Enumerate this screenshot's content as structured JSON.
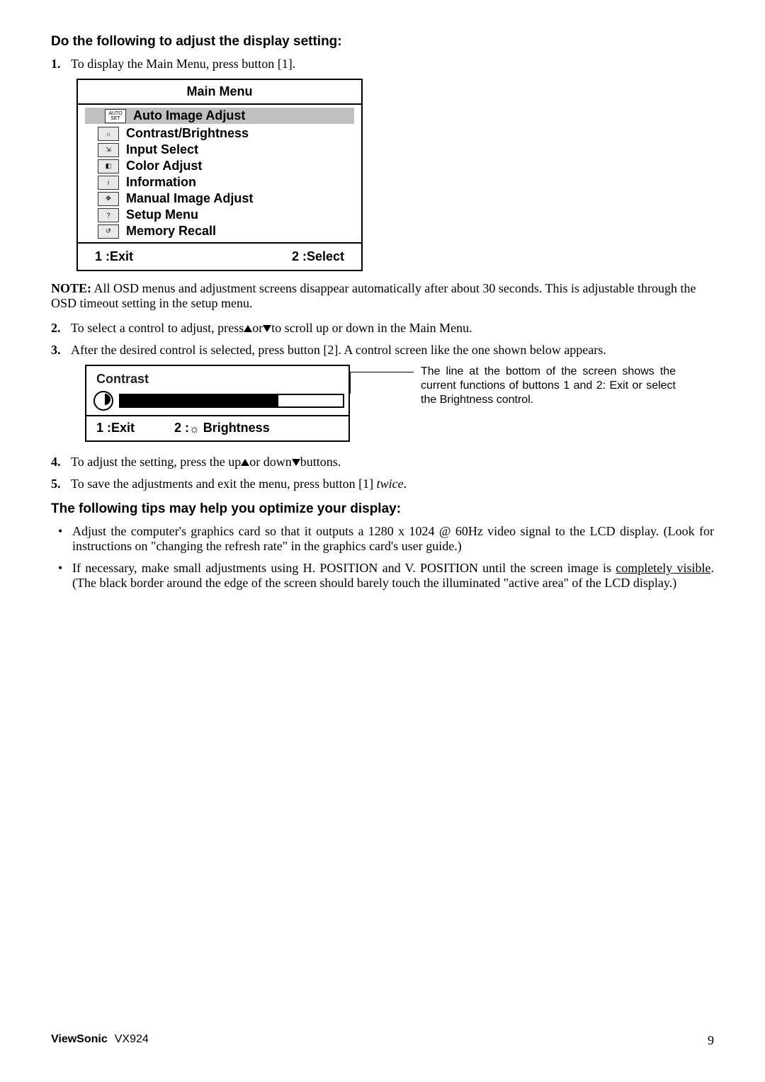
{
  "heading1": "Do the following to adjust the display setting:",
  "step1_num": "1.",
  "step1_txt": "To display the Main Menu, press button [1].",
  "osd": {
    "title": "Main Menu",
    "items": [
      {
        "icon": "AUTO SET",
        "label": "Auto Image Adjust",
        "selected": true
      },
      {
        "icon": "☼",
        "label": "Contrast/Brightness"
      },
      {
        "icon": "⇲",
        "label": "Input Select"
      },
      {
        "icon": "◧",
        "label": "Color Adjust"
      },
      {
        "icon": "i",
        "label": "Information"
      },
      {
        "icon": "✥",
        "label": "Manual Image Adjust"
      },
      {
        "icon": "?",
        "label": "Setup Menu"
      },
      {
        "icon": "↺",
        "label": "Memory Recall"
      }
    ],
    "footer_left": "1 :Exit",
    "footer_right": "2 :Select"
  },
  "note_label": "NOTE:",
  "note_txt": " All OSD menus and adjustment screens disappear automatically after about 30 seconds. This is adjustable through the OSD timeout setting in the setup menu.",
  "step2_num": "2.",
  "step2_pre": "To select a control to adjust, press",
  "step2_mid": "or",
  "step2_post": "to scroll up or down in the Main Menu.",
  "step3_num": "3.",
  "step3_txt": "After the desired control is selected, press button [2]. A control screen like the one shown below appears.",
  "contrast": {
    "title": "Contrast",
    "footer_left": "1 :Exit",
    "footer_right_pre": "2 :",
    "footer_right_post": " Brightness"
  },
  "callout": "The line at the bottom of the screen shows the current functions of buttons 1 and 2: Exit or select the Brightness control.",
  "step4_num": "4.",
  "step4_pre": "To adjust the setting, press the up",
  "step4_mid": "or down",
  "step4_post": "buttons.",
  "step5_num": "5.",
  "step5_pre": "To save the adjustments and exit the menu, press button [1] ",
  "step5_ital": "twice",
  "step5_post": ".",
  "heading2": "The following tips may help you optimize your display:",
  "tip1": "Adjust the computer's graphics card so that it outputs a 1280 x 1024 @ 60Hz video signal to the LCD display. (Look for instructions on \"changing the refresh rate\" in the graphics card's user guide.)",
  "tip2_pre": "If necessary, make small adjustments using H. POSITION and V. POSITION until the screen image is ",
  "tip2_u": "completely visible",
  "tip2_post": ". (The black border around the edge of the screen should barely touch the illuminated \"active area\" of the LCD display.)",
  "footer": {
    "brand": "ViewSonic",
    "model": "VX924",
    "page": "9"
  }
}
